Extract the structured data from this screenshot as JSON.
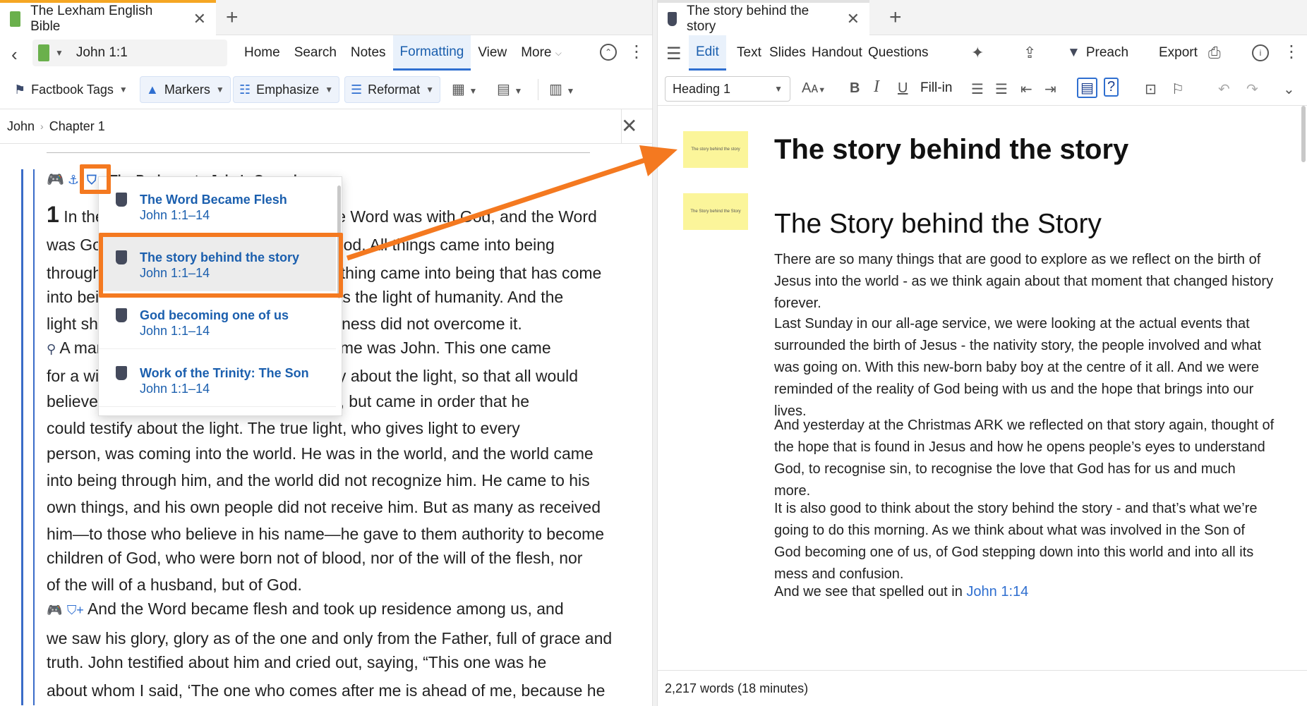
{
  "left": {
    "tab": {
      "title": "The Lexham English Bible",
      "close": "✕",
      "new_tab": "+"
    },
    "nav": {
      "back": "‹",
      "reference": "John 1:1",
      "menu": [
        "Home",
        "Search",
        "Notes",
        "Formatting",
        "View",
        "More"
      ],
      "selected_menu": "Formatting",
      "more_caret": "⌵"
    },
    "formatting": {
      "factbook": "Factbook Tags",
      "markers": "Markers",
      "emphasize": "Emphasize",
      "reformat": "Reformat"
    },
    "breadcrumb": {
      "book": "John",
      "chapter": "Chapter 1",
      "sep": "›",
      "close": "✕"
    },
    "heading_fragment": "The Prologue to John's Gospel",
    "lines": [
      "In the beginning was the Word, and the Word was with God, and the Word",
      "was God. He was in the beginning with God. All things came into being",
      "through him, and apart from him not one thing came into being that has come",
      "into being. In him was life, and the life was the light of humanity. And the",
      "light shines in the darkness, and the darkness did not overcome it.",
      "A man came, sent from God, whose name was John. This one came",
      "for a witness, in order that he could testify about the light, so that all would",
      "believe through him. He was not the light, but came in order that he",
      "could testify about the light. The true light, who gives light to every",
      "person, was coming into the world. He was in the world, and the world came",
      "into being through him, and the world did not recognize him. He came to his",
      "own things, and his own people did not receive him. But as many as received",
      "him—to those who believe in his name—he gave to them authority to become",
      "children of God, who were born not of blood, nor of the will of the flesh, nor",
      "of the will of a husband, but of God.",
      "And the Word became flesh and took up residence among us, and",
      "we saw his glory, glory as of the one and only from the Father, full of grace and",
      "truth. John testified about him and cried out, saying, “This one was he",
      "about whom I said, ‘The one who comes after me is ahead of me, because he"
    ],
    "popup": [
      {
        "title": "The Word Became Flesh",
        "ref": "John 1:1–14"
      },
      {
        "title": "The story behind the story",
        "ref": "John 1:1–14"
      },
      {
        "title": "God becoming one of us",
        "ref": "John 1:1–14"
      },
      {
        "title": "Work of the Trinity: The Son",
        "ref": "John 1:1–14"
      }
    ]
  },
  "right": {
    "tab": {
      "title": "The story behind the story",
      "close": "✕",
      "new_tab": "+"
    },
    "menu": [
      "Edit",
      "Text",
      "Slides",
      "Handout",
      "Questions"
    ],
    "selected_menu": "Edit",
    "preach": "Preach",
    "export": "Export",
    "style": "Heading 1",
    "fillin": "Fill-in",
    "thumb_text_1": "The story behind the story",
    "thumb_text_2": "The Story behind the Story",
    "title": "The story behind the story",
    "subtitle": "The Story behind the Story",
    "paragraphs": [
      "There are so many things that are good to explore as we reflect on the birth of Jesus into the world - as we think again about that moment that changed history forever.",
      "Last Sunday in our all-age service, we were looking at the actual events that surrounded the birth of Jesus - the nativity story, the people involved and what was going on. With this new-born baby boy at the centre of it all. And we were reminded of the reality of God being with us and the hope that brings into our lives.",
      "And yesterday at the Christmas ARK we reflected on that story again, thought of the hope that is found in Jesus and how he opens people’s eyes to understand God, to recognise sin, to recognise the love that God has for us and much more.",
      "It is also good to think about the story behind the story - and that’s what we’re going to do this morning. As we think about what was involved in the Son of God becoming one of us, of God stepping down into this world and into all its mess and confusion."
    ],
    "last_para_text": "And we see that spelled out in ",
    "last_para_link": "John 1:14",
    "status": "2,217 words (18 minutes)"
  },
  "colors": {
    "accent": "#2f6fd0",
    "highlight": "#f47920",
    "tab_left": "#f5a623",
    "note_yellow": "#fbf59a"
  }
}
